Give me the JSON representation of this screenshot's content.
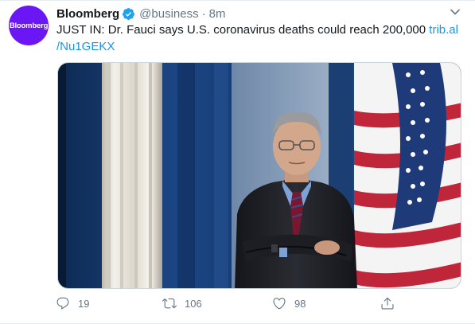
{
  "account": {
    "avatar_text": "Bloomberg",
    "name": "Bloomberg",
    "handle": "@business",
    "separator": "·",
    "time": "8m",
    "brand_color": "#6b16f4",
    "verified_color": "#1da1f2"
  },
  "tweet": {
    "text": "JUST IN: Dr. Fauci says U.S. coronavirus deaths could reach 200,000",
    "link_part1": "trib.al",
    "link_part2": "/Nu1GEKX",
    "link_color": "#1b95e0"
  },
  "media": {
    "description_icon": "photo"
  },
  "actions": {
    "reply_count": "19",
    "retweet_count": "106",
    "like_count": "98",
    "icons": [
      "reply-icon",
      "retweet-icon",
      "like-icon",
      "share-icon"
    ]
  }
}
